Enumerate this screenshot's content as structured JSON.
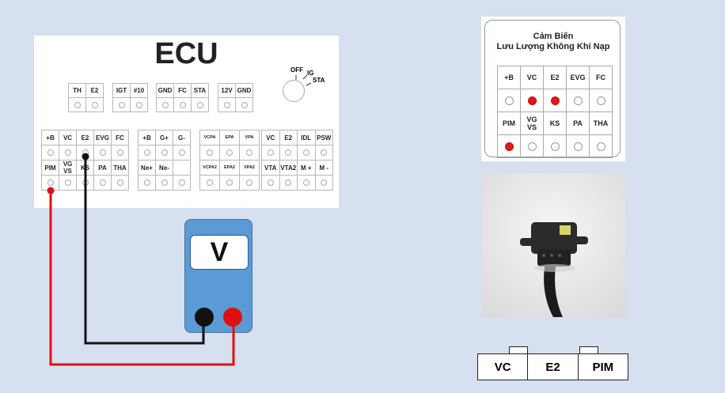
{
  "ecu": {
    "title": "ECU",
    "ignition": {
      "off": "OFF",
      "ig": "IG",
      "sta": "STA"
    },
    "top_groups": [
      [
        "TH",
        "E2"
      ],
      [
        "IGT",
        "#10"
      ],
      [
        "GND",
        "FC",
        "STA"
      ],
      [
        "12V",
        "GND"
      ]
    ],
    "main_groups": [
      {
        "cols": 5,
        "row1": [
          "+B",
          "VC",
          "E2",
          "EVG",
          "FC"
        ],
        "row2": [
          "PIM",
          "VG\nVS",
          "KS",
          "PA",
          "THA"
        ]
      },
      {
        "cols": 3,
        "row1": [
          "+B",
          "G+",
          "G-"
        ],
        "row2": [
          "Ne+",
          "Ne-",
          ""
        ]
      },
      {
        "cols": 3,
        "row1": [
          "VCPA",
          "EPA",
          "VPA"
        ],
        "row2": [
          "VCPA2",
          "EPA2",
          "VPA2"
        ],
        "small": true
      },
      {
        "cols": 4,
        "row1": [
          "VC",
          "E2",
          "IDL",
          "PSW"
        ],
        "row2": [
          "VTA",
          "VTA2",
          "M +",
          "M -"
        ]
      }
    ]
  },
  "meter": {
    "label": "V"
  },
  "sensor": {
    "title_line1": "Cảm Biến",
    "title_line2": "Lưu Lượng Không Khí Nạp",
    "row1": [
      "+B",
      "VC",
      "E2",
      "EVG",
      "FC"
    ],
    "row1_active": [
      false,
      true,
      true,
      false,
      false
    ],
    "row2": [
      "PIM",
      "VG\nVS",
      "KS",
      "PA",
      "THA"
    ],
    "row2_active": [
      true,
      false,
      false,
      false,
      false
    ]
  },
  "connector": [
    "VC",
    "E2",
    "PIM"
  ],
  "colors": {
    "wire_red": "#e01010",
    "wire_black": "#111111",
    "meter": "#5b9bd5",
    "background": "#d6e0f0"
  }
}
